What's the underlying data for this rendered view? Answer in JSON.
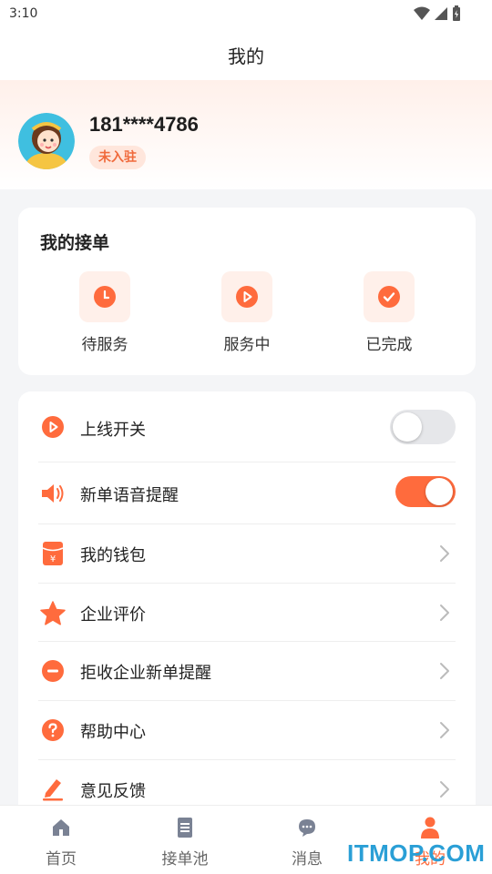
{
  "status": {
    "time": "3:10"
  },
  "header": {
    "title": "我的"
  },
  "profile": {
    "phone": "181****4786",
    "badge": "未入驻"
  },
  "orders": {
    "title": "我的接单",
    "items": [
      {
        "label": "待服务",
        "icon": "clock-icon"
      },
      {
        "label": "服务中",
        "icon": "play-icon"
      },
      {
        "label": "已完成",
        "icon": "check-icon"
      }
    ]
  },
  "menu": {
    "items": [
      {
        "label": "上线开关",
        "icon": "play-circle-icon",
        "toggle_on": false
      },
      {
        "label": "新单语音提醒",
        "icon": "speaker-icon",
        "toggle_on": true
      },
      {
        "label": "我的钱包",
        "icon": "wallet-icon"
      },
      {
        "label": "企业评价",
        "icon": "star-icon"
      },
      {
        "label": "拒收企业新单提醒",
        "icon": "minus-circle-icon"
      },
      {
        "label": "帮助中心",
        "icon": "question-circle-icon"
      },
      {
        "label": "意见反馈",
        "icon": "edit-icon"
      }
    ]
  },
  "tabbar": {
    "items": [
      {
        "label": "首页",
        "icon": "home-icon"
      },
      {
        "label": "接单池",
        "icon": "document-icon"
      },
      {
        "label": "消息",
        "icon": "chat-icon"
      },
      {
        "label": "我的",
        "icon": "user-icon",
        "active": true
      }
    ]
  },
  "watermark": "ITMOP.COM",
  "colors": {
    "accent": "#ff6b3d",
    "accent_light": "#fff0ea",
    "background": "#f4f5f7"
  }
}
